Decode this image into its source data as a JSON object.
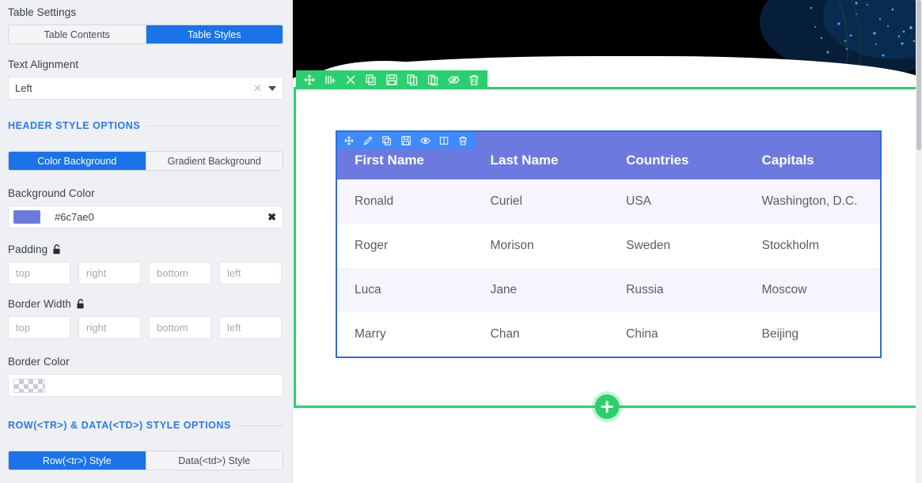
{
  "sidebar": {
    "title": "Table Settings",
    "main_tabs": [
      {
        "label": "Table Contents",
        "active": false
      },
      {
        "label": "Table Styles",
        "active": true
      }
    ],
    "text_alignment": {
      "label": "Text Alignment",
      "value": "Left",
      "clear_icon": "close-icon",
      "caret_icon": "chevron-down-icon"
    },
    "header_section": {
      "title": "HEADER STYLE OPTIONS",
      "bg_tabs": [
        {
          "label": "Color Background",
          "active": true
        },
        {
          "label": "Gradient Background",
          "active": false
        }
      ],
      "background_color": {
        "label": "Background Color",
        "value": "#6c7ae0",
        "swatch_hex": "#6c7ae0",
        "clear_icon": "close-icon"
      },
      "padding": {
        "label": "Padding",
        "lock_icon": "unlock-icon",
        "placeholders": [
          "top",
          "right",
          "bottom",
          "left"
        ],
        "values": [
          "",
          "",
          "",
          ""
        ]
      },
      "border_width": {
        "label": "Border Width",
        "lock_icon": "unlock-icon",
        "placeholders": [
          "top",
          "right",
          "bottom",
          "left"
        ],
        "values": [
          "",
          "",
          "",
          ""
        ]
      },
      "border_color": {
        "label": "Border Color",
        "value": "",
        "swatch": "transparent-checker"
      }
    },
    "row_section": {
      "title": "ROW(<TR>) & DATA(<TD>) STYLE OPTIONS",
      "tabs": [
        {
          "label": "Row(<tr>) Style",
          "active": true
        },
        {
          "label": "Data(<td>) Style",
          "active": false
        }
      ]
    }
  },
  "canvas": {
    "hero_image": "night-sky-aurora-snow-photo",
    "block_toolbar": {
      "accent": "#2ad06d",
      "icons": [
        "move-icon",
        "add-column-icon",
        "scissors-icon",
        "duplicate-icon",
        "save-icon",
        "copy-icon",
        "paste-icon",
        "eye-off-icon",
        "trash-icon"
      ]
    },
    "add_block_button": {
      "icon": "plus-icon",
      "color": "#2ad06d"
    },
    "table_toolbar": {
      "accent": "#3d8bfd",
      "icons": [
        "move-icon",
        "edit-pencil-icon",
        "duplicate-icon",
        "save-icon",
        "eye-icon",
        "columns-icon",
        "trash-icon"
      ]
    },
    "table": {
      "border_color": "#2f6bdd",
      "header_bg": "#6c7ae0",
      "headers": [
        "First Name",
        "Last Name",
        "Countries",
        "Capitals"
      ],
      "rows": [
        [
          "Ronald",
          "Curiel",
          "USA",
          "Washington, D.C."
        ],
        [
          "Roger",
          "Morison",
          "Sweden",
          "Stockholm"
        ],
        [
          "Luca",
          "Jane",
          "Russia",
          "Moscow"
        ],
        [
          "Marry",
          "Chan",
          "China",
          "Beijing"
        ]
      ]
    }
  }
}
